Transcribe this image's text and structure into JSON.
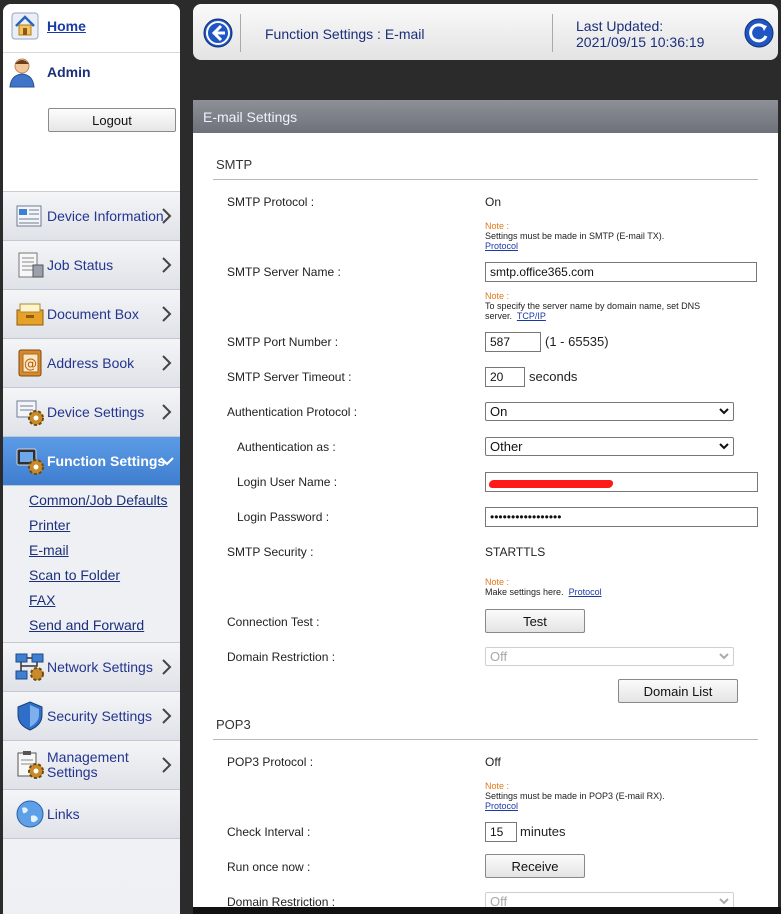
{
  "sidebar": {
    "home_label": "Home",
    "user_label": "Admin",
    "logout_label": "Logout",
    "menu": [
      {
        "label": "Device Information"
      },
      {
        "label": "Job Status"
      },
      {
        "label": "Document Box"
      },
      {
        "label": "Address Book"
      },
      {
        "label": "Device Settings"
      },
      {
        "label": "Function Settings"
      },
      {
        "label": "Network Settings"
      },
      {
        "label": "Security Settings"
      },
      {
        "label": "Management Settings"
      },
      {
        "label": "Links"
      }
    ],
    "submenu": [
      "Common/Job Defaults",
      "Printer",
      "E-mail",
      "Scan to Folder",
      "FAX",
      "Send and Forward"
    ]
  },
  "header": {
    "title": "Function Settings : E-mail",
    "updated_label": "Last Updated:",
    "updated_value": "2021/09/15 10:36:19"
  },
  "panel": {
    "title": "E-mail Settings",
    "smtp": {
      "section": "SMTP",
      "protocol_label": "SMTP Protocol :",
      "protocol_value": "On",
      "note1_title": "Note :",
      "note1_text": "Settings must be made in SMTP (E-mail TX).",
      "note1_link": "Protocol",
      "server_label": "SMTP Server Name :",
      "server_value": "smtp.office365.com",
      "note2_title": "Note :",
      "note2_text": "To specify the server name by domain name, set DNS server.",
      "note2_link": "TCP/IP",
      "port_label": "SMTP Port Number :",
      "port_value": "587",
      "port_range": "(1 - 65535)",
      "timeout_label": "SMTP Server Timeout :",
      "timeout_value": "20",
      "timeout_unit": "seconds",
      "auth_label": "Authentication Protocol :",
      "auth_value": "On",
      "auth_as_label": "Authentication as :",
      "auth_as_value": "Other",
      "login_user_label": "Login User Name :",
      "login_user_value": "",
      "login_pw_label": "Login Password :",
      "login_pw_value": "•••••••••••••••••",
      "security_label": "SMTP Security :",
      "security_value": "STARTTLS",
      "note3_title": "Note :",
      "note3_text": "Make settings here.",
      "note3_link": "Protocol",
      "conn_test_label": "Connection Test :",
      "test_button": "Test",
      "domain_label": "Domain Restriction :",
      "domain_value": "Off",
      "domain_list_button": "Domain List"
    },
    "pop3": {
      "section": "POP3",
      "protocol_label": "POP3 Protocol :",
      "protocol_value": "Off",
      "note_title": "Note :",
      "note_text": "Settings must be made in POP3 (E-mail RX).",
      "note_link": "Protocol",
      "interval_label": "Check Interval :",
      "interval_value": "15",
      "interval_unit": "minutes",
      "run_label": "Run once now :",
      "receive_button": "Receive",
      "domain_label": "Domain Restriction :",
      "domain_value": "Off"
    }
  }
}
